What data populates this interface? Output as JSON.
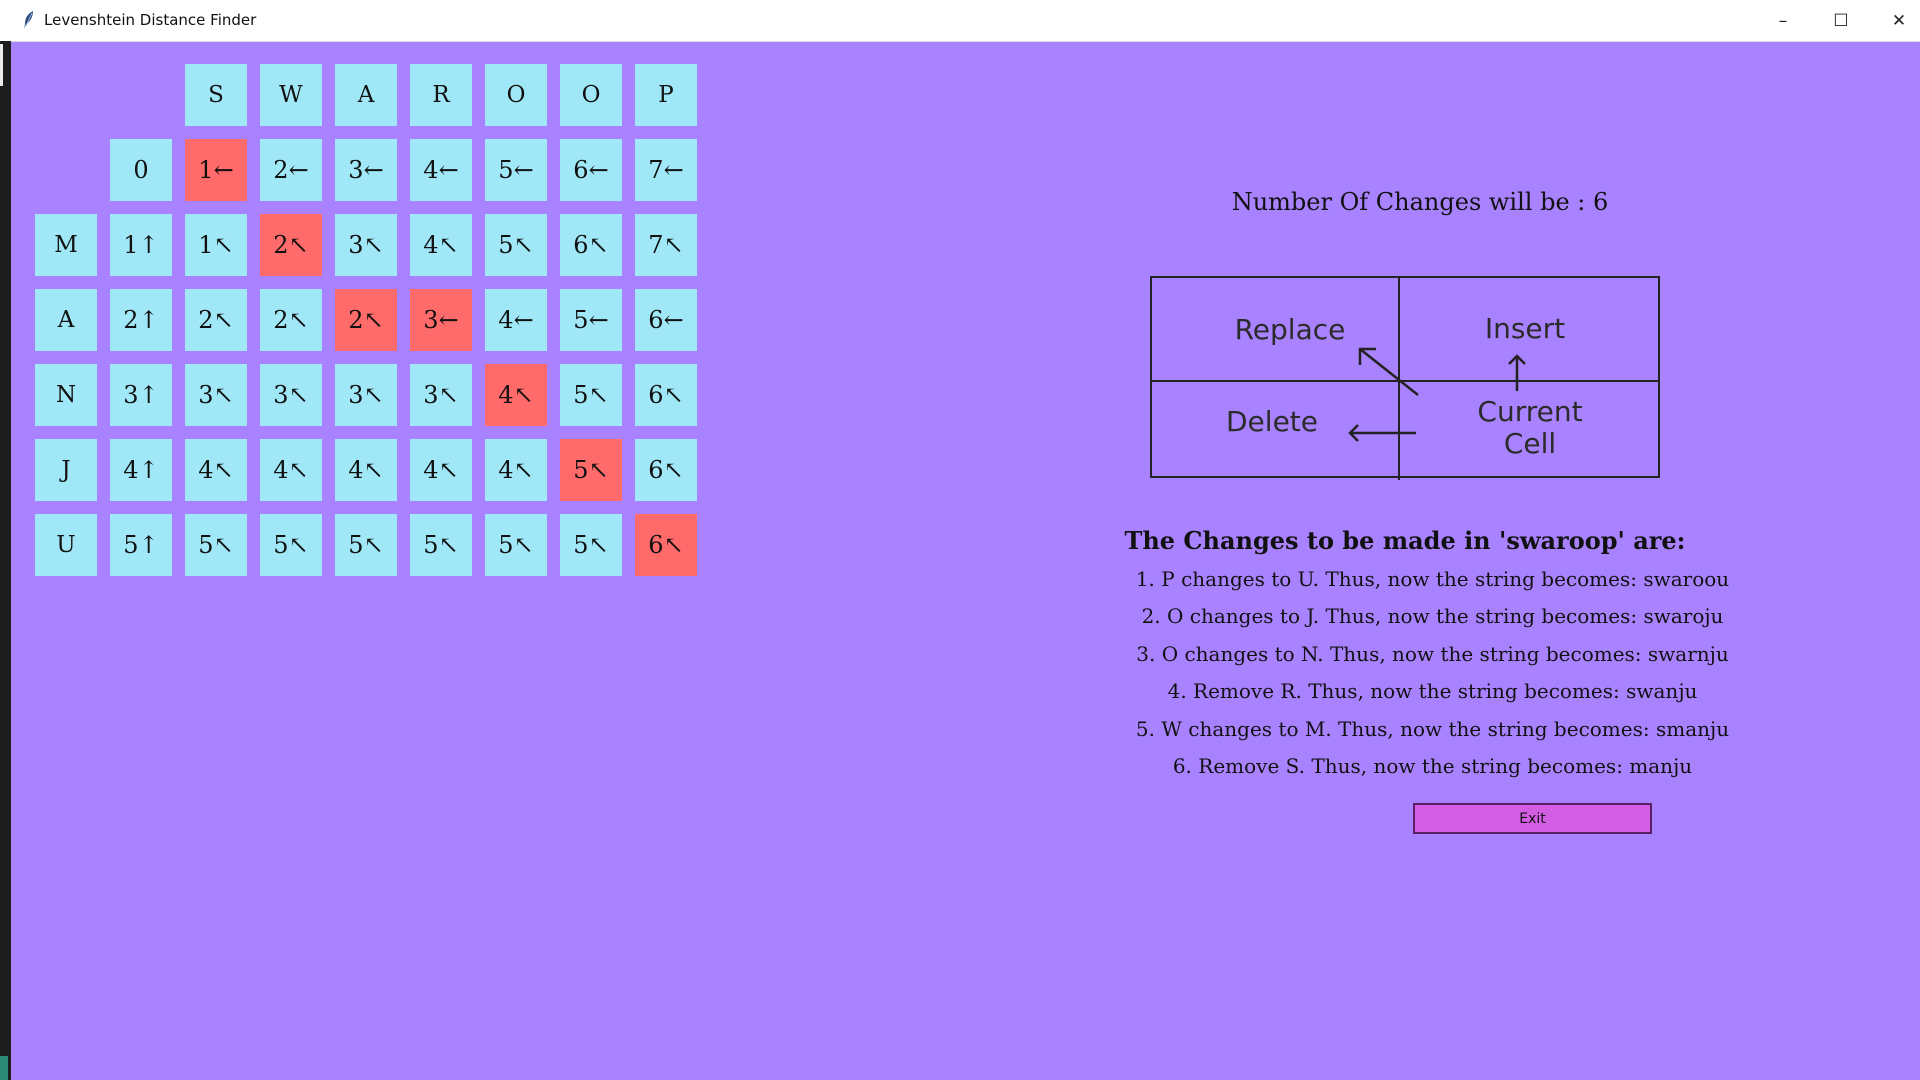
{
  "window": {
    "title": "Levenshtein Distance Finder",
    "controls": {
      "minimize": "–",
      "maximize": "☐",
      "close": "✕"
    }
  },
  "grid": {
    "column_headers": [
      "S",
      "W",
      "A",
      "R",
      "O",
      "O",
      "P"
    ],
    "row_headers": [
      "M",
      "A",
      "N",
      "J",
      "U"
    ],
    "rows": [
      [
        {
          "v": "0",
          "p": false
        },
        {
          "v": "1←",
          "p": true
        },
        {
          "v": "2←",
          "p": false
        },
        {
          "v": "3←",
          "p": false
        },
        {
          "v": "4←",
          "p": false
        },
        {
          "v": "5←",
          "p": false
        },
        {
          "v": "6←",
          "p": false
        },
        {
          "v": "7←",
          "p": false
        }
      ],
      [
        {
          "v": "1↑",
          "p": false
        },
        {
          "v": "1↖",
          "p": false
        },
        {
          "v": "2↖",
          "p": true
        },
        {
          "v": "3↖",
          "p": false
        },
        {
          "v": "4↖",
          "p": false
        },
        {
          "v": "5↖",
          "p": false
        },
        {
          "v": "6↖",
          "p": false
        },
        {
          "v": "7↖",
          "p": false
        }
      ],
      [
        {
          "v": "2↑",
          "p": false
        },
        {
          "v": "2↖",
          "p": false
        },
        {
          "v": "2↖",
          "p": false
        },
        {
          "v": "2↖",
          "p": true
        },
        {
          "v": "3←",
          "p": true
        },
        {
          "v": "4←",
          "p": false
        },
        {
          "v": "5←",
          "p": false
        },
        {
          "v": "6←",
          "p": false
        }
      ],
      [
        {
          "v": "3↑",
          "p": false
        },
        {
          "v": "3↖",
          "p": false
        },
        {
          "v": "3↖",
          "p": false
        },
        {
          "v": "3↖",
          "p": false
        },
        {
          "v": "3↖",
          "p": false
        },
        {
          "v": "4↖",
          "p": true
        },
        {
          "v": "5↖",
          "p": false
        },
        {
          "v": "6↖",
          "p": false
        }
      ],
      [
        {
          "v": "4↑",
          "p": false
        },
        {
          "v": "4↖",
          "p": false
        },
        {
          "v": "4↖",
          "p": false
        },
        {
          "v": "4↖",
          "p": false
        },
        {
          "v": "4↖",
          "p": false
        },
        {
          "v": "4↖",
          "p": false
        },
        {
          "v": "5↖",
          "p": true
        },
        {
          "v": "6↖",
          "p": false
        }
      ],
      [
        {
          "v": "5↑",
          "p": false
        },
        {
          "v": "5↖",
          "p": false
        },
        {
          "v": "5↖",
          "p": false
        },
        {
          "v": "5↖",
          "p": false
        },
        {
          "v": "5↖",
          "p": false
        },
        {
          "v": "5↖",
          "p": false
        },
        {
          "v": "5↖",
          "p": false
        },
        {
          "v": "6↖",
          "p": true
        }
      ]
    ],
    "colors": {
      "cell": "#a0e8f8",
      "path": "#ff6a6a"
    }
  },
  "result": {
    "text": "Number Of Changes will be : 6"
  },
  "legend": {
    "replace": "Replace",
    "insert": "Insert",
    "delete": "Delete",
    "current_line1": "Current",
    "current_line2": "Cell"
  },
  "changes": {
    "heading": "The Changes to be made in 'swaroop' are:",
    "items": [
      "1. P changes to U. Thus, now the string becomes: swaroou",
      "2. O changes to J. Thus, now the string becomes: swaroju",
      "3. O changes to N. Thus, now the string becomes: swarnju",
      "4. Remove R. Thus, now the string becomes: swanju",
      "5. W changes to M. Thus, now the string becomes: smanju",
      "6. Remove S. Thus, now the string becomes: manju"
    ]
  },
  "exit_button": {
    "label": "Exit"
  },
  "background_color": "#a982ff"
}
